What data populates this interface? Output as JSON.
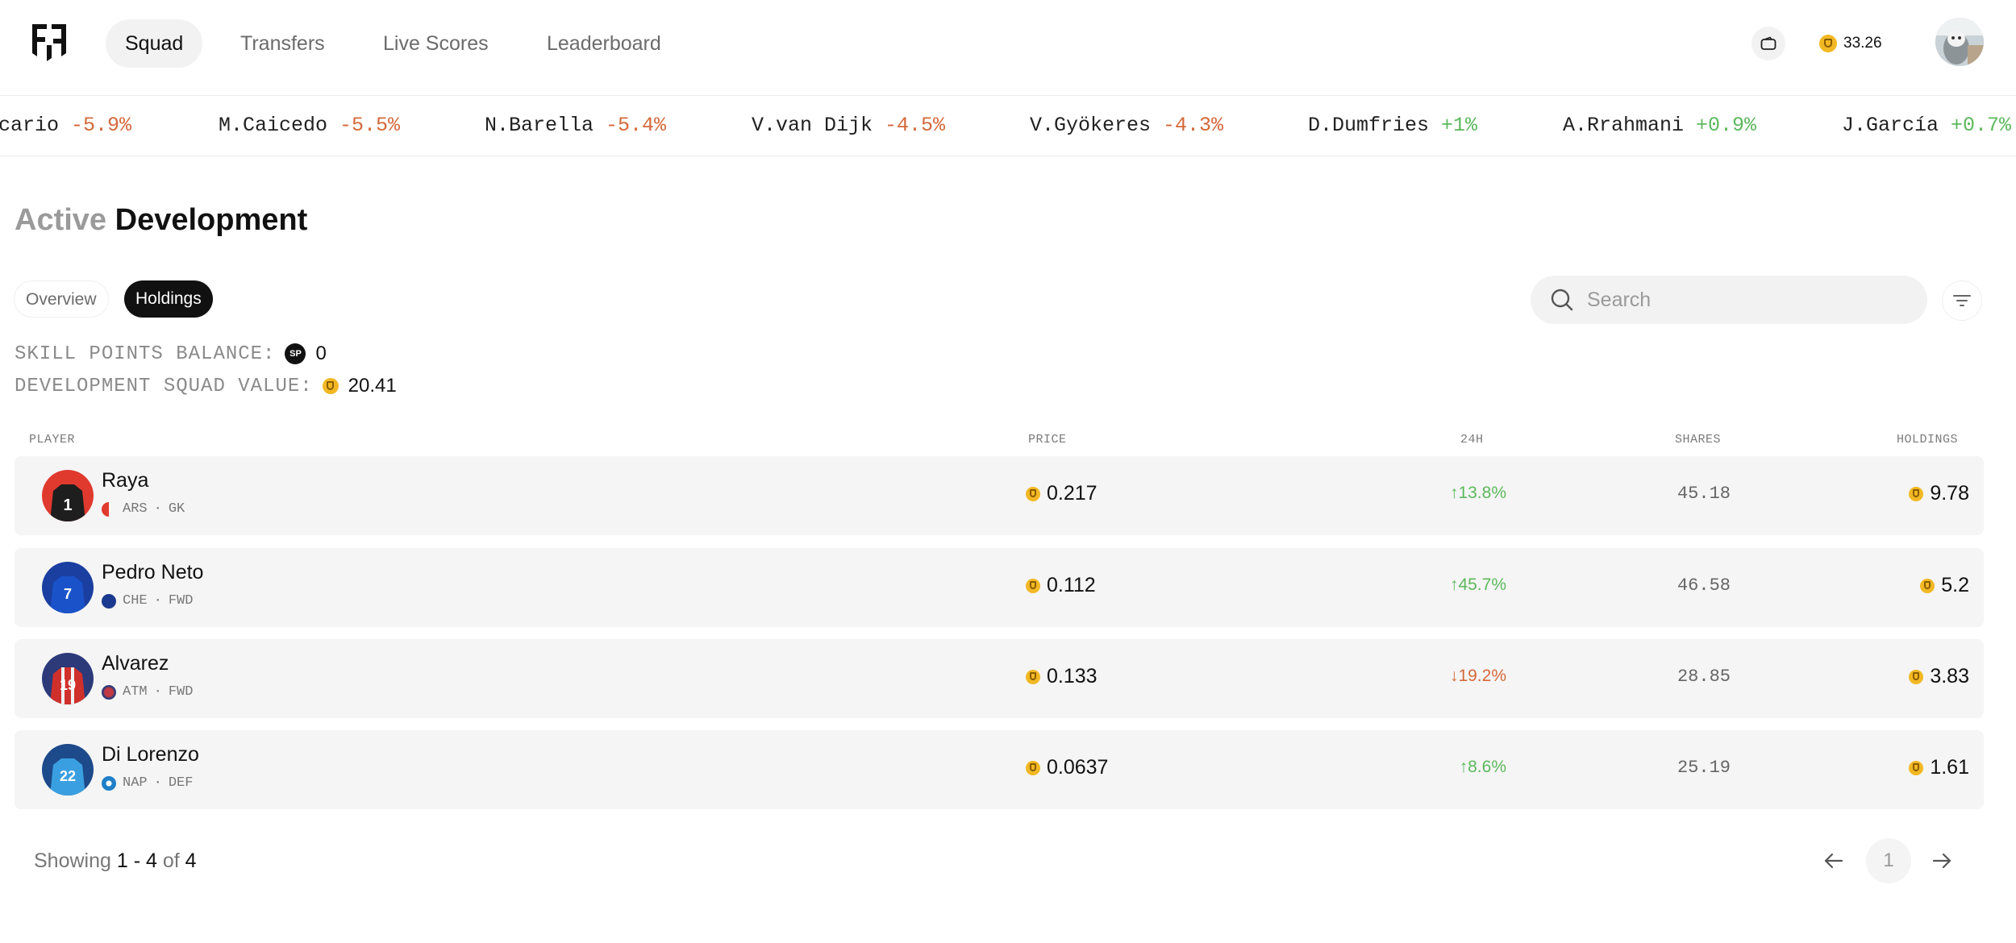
{
  "nav": {
    "tabs": [
      {
        "label": "Squad",
        "active": true
      },
      {
        "label": "Transfers",
        "active": false
      },
      {
        "label": "Live Scores",
        "active": false
      },
      {
        "label": "Leaderboard",
        "active": false
      }
    ],
    "balance": "33.26",
    "icons": [
      "logo-icon",
      "wallet-icon",
      "coin-icon",
      "avatar"
    ]
  },
  "ticker": [
    {
      "name": "cario",
      "change": "-5.9%",
      "dir": "down"
    },
    {
      "name": "M.Caicedo",
      "change": "-5.5%",
      "dir": "down"
    },
    {
      "name": "N.Barella",
      "change": "-5.4%",
      "dir": "down"
    },
    {
      "name": "V.van Dijk",
      "change": "-4.5%",
      "dir": "down"
    },
    {
      "name": "V.Gyökeres",
      "change": "-4.3%",
      "dir": "down"
    },
    {
      "name": "D.Dumfries",
      "change": "+1%",
      "dir": "up"
    },
    {
      "name": "A.Rrahmani",
      "change": "+0.9%",
      "dir": "up"
    },
    {
      "name": "J.García",
      "change": "+0.7%",
      "dir": "up"
    }
  ],
  "page": {
    "title_muted": "Active",
    "title_main": "Development",
    "subtabs": [
      {
        "label": "Overview",
        "active": false
      },
      {
        "label": "Holdings",
        "active": true
      }
    ],
    "search_placeholder": "Search",
    "skill_points_label": "SKILL POINTS BALANCE:",
    "skill_points_badge": "SP",
    "skill_points_value": "0",
    "squad_value_label": "DEVELOPMENT SQUAD VALUE:",
    "squad_value": "20.41"
  },
  "table": {
    "headers": {
      "player": "PLAYER",
      "price": "PRICE",
      "change": "24H",
      "shares": "SHARES",
      "holdings": "HOLDINGS"
    },
    "rows": [
      {
        "name": "Raya",
        "club": "ARS",
        "pos": "GK",
        "price": "0.217",
        "change": "↑13.8%",
        "dir": "up",
        "shares": "45.18",
        "holdings": "9.78",
        "kit_number": "1",
        "kit_color": "#1e1e1e",
        "bg_color": "#e03a2f",
        "club_color": "#e03a2f"
      },
      {
        "name": "Pedro Neto",
        "club": "CHE",
        "pos": "FWD",
        "price": "0.112",
        "change": "↑45.7%",
        "dir": "up",
        "shares": "46.58",
        "holdings": "5.2",
        "kit_number": "7",
        "kit_color": "#1448b8",
        "bg_color": "#1b3fa0",
        "club_color": "#1b3a8f"
      },
      {
        "name": "Alvarez",
        "club": "ATM",
        "pos": "FWD",
        "price": "0.133",
        "change": "↓19.2%",
        "dir": "down",
        "shares": "28.85",
        "holdings": "3.83",
        "kit_number": "19",
        "kit_color": "#d0302b",
        "bg_color": "#2c3a7a",
        "club_color": "#a33040"
      },
      {
        "name": "Di Lorenzo",
        "club": "NAP",
        "pos": "DEF",
        "price": "0.0637",
        "change": "↑8.6%",
        "dir": "up",
        "shares": "25.19",
        "holdings": "1.61",
        "kit_number": "22",
        "kit_color": "#3a9fe0",
        "bg_color": "#1d4a8a",
        "club_color": "#1f7fc9"
      }
    ]
  },
  "footer": {
    "showing_prefix": "Showing ",
    "range": "1 - 4",
    "of_word": " of ",
    "total": "4",
    "current_page": "1"
  },
  "colors": {
    "positive": "#5cb85c",
    "negative": "#d4693b",
    "coin": "#f2b824",
    "active_tab": "#111111"
  }
}
